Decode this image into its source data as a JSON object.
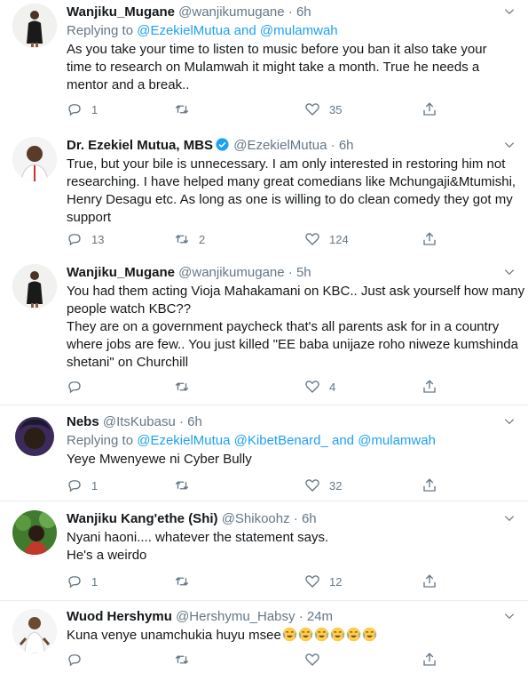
{
  "tweets": [
    {
      "name": "Wanjiku_Mugane",
      "handle": "@wanjikumugane",
      "dot": "·",
      "time": "6h",
      "verified": false,
      "replying_prefix": "Replying to ",
      "replying_mentions": [
        "@EzekielMutua",
        "@mulamwah"
      ],
      "replying_joiners": [
        " and "
      ],
      "lines": [
        "As you take your time to listen to music before you ban it also take your",
        "time to research on Mulamwah it might take a month. True he needs a",
        "mentor and a break.."
      ],
      "replies": "1",
      "retweets": "",
      "likes": "35"
    },
    {
      "name": "Dr. Ezekiel Mutua, MBS",
      "handle": "@EzekielMutua",
      "dot": "·",
      "time": "6h",
      "verified": true,
      "lines": [
        "True, but your bile is unnecessary. I am only interested in restoring him not",
        "researching. I have helped many great comedians like Mchungaji&Mtumishi,",
        "Henry Desagu etc. As long as one is willing to do clean comedy they got my",
        "support"
      ],
      "replies": "13",
      "retweets": "2",
      "likes": "124"
    },
    {
      "name": "Wanjiku_Mugane",
      "handle": "@wanjikumugane",
      "dot": "·",
      "time": "5h",
      "verified": false,
      "lines": [
        "You had them acting Vioja Mahakamani on KBC.. Just ask yourself how many",
        "people watch KBC??",
        "They are on a government paycheck  that's all parents ask for in a country",
        "where jobs are few.. You just killed \"EE baba unijaze roho niweze kumshinda",
        "shetani\" on Churchill"
      ],
      "replies": "",
      "retweets": "",
      "likes": "4"
    },
    {
      "name": "Nebs",
      "handle": "@ItsKubasu",
      "dot": "·",
      "time": "6h",
      "verified": false,
      "replying_prefix": "Replying to ",
      "replying_mentions": [
        "@EzekielMutua",
        "@KibetBenard_",
        "and",
        "@mulamwah"
      ],
      "lines": [
        "Yeye Mwenyewe ni Cyber Bully"
      ],
      "replies": "1",
      "retweets": "",
      "likes": "32"
    },
    {
      "name": "Wanjiku Kang'ethe (Shi)",
      "handle": "@Shikoohz",
      "dot": "·",
      "time": "6h",
      "verified": false,
      "lines": [
        "Nyani haoni.... whatever the statement says.",
        "He's a weirdo"
      ],
      "replies": "1",
      "retweets": "",
      "likes": "12"
    },
    {
      "name": "Wuod Hershymu",
      "handle": "@Hershymu_Habsy",
      "dot": "·",
      "time": "24m",
      "verified": false,
      "lines": [
        "Kuna venye unamchukia huyu msee"
      ],
      "emoji_count": 6,
      "emoji_name": "face-with-tears-of-joy-emoji",
      "replies": "",
      "retweets": "",
      "likes": ""
    }
  ],
  "colors": {
    "text": "#14171a",
    "secondary": "#657786",
    "link": "#1da1f2",
    "divider": "#e6ecf0",
    "verified": "#1da1f2"
  },
  "icons": {
    "reply": "reply-icon",
    "retweet": "retweet-icon",
    "like": "heart-icon",
    "share": "share-icon",
    "caret": "chevron-down-icon",
    "verified": "verified-badge-icon"
  }
}
